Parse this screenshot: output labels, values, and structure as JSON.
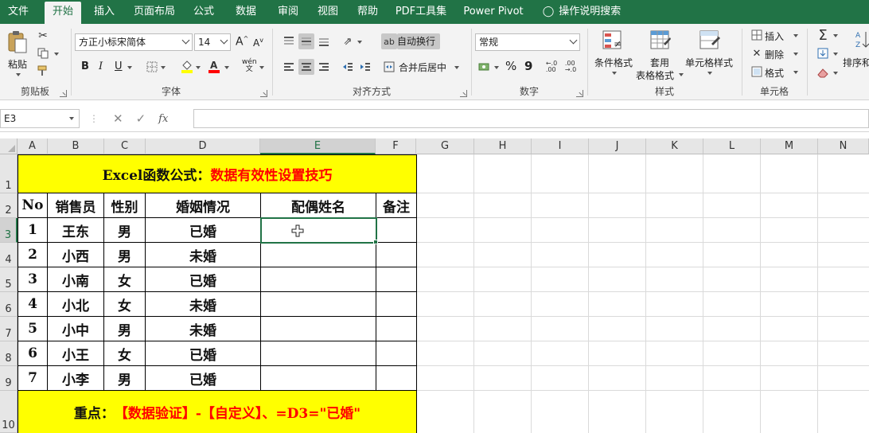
{
  "tabs": [
    "文件",
    "开始",
    "插入",
    "页面布局",
    "公式",
    "数据",
    "审阅",
    "视图",
    "帮助",
    "PDF工具集",
    "Power Pivot",
    "操作说明搜索"
  ],
  "active_tab": "开始",
  "ribbon": {
    "clipboard": {
      "label": "剪贴板",
      "paste": "粘贴"
    },
    "font": {
      "label": "字体",
      "font_name": "方正小标宋简体",
      "font_size": "14",
      "bold": "B",
      "italic": "I",
      "underline": "U",
      "grow": "A",
      "shrink": "A",
      "phonetic": "wén"
    },
    "align": {
      "label": "对齐方式",
      "wrap_text": "自动换行",
      "merge_center": "合并后居中"
    },
    "number": {
      "label": "数字",
      "format": "常规",
      "percent": "%",
      "comma": "9"
    },
    "styles": {
      "label": "样式",
      "conditional": "条件格式",
      "table_format_1": "套用",
      "table_format_2": "表格格式",
      "cell_styles": "单元格样式"
    },
    "cells": {
      "label": "单元格",
      "insert": "插入",
      "delete": "删除",
      "format": "格式"
    },
    "editing": {
      "sort": "排序和"
    }
  },
  "formula_bar": {
    "name_box": "E3",
    "fx": "fx",
    "content": ""
  },
  "columns": [
    "A",
    "B",
    "C",
    "D",
    "E",
    "F",
    "G",
    "H",
    "I",
    "J",
    "K",
    "L",
    "M",
    "N"
  ],
  "rows": [
    "1",
    "2",
    "3",
    "4",
    "5",
    "6",
    "7",
    "8",
    "9",
    "10"
  ],
  "selected_cell": "E3",
  "sheet": {
    "title_black": "Excel函数公式：",
    "title_red": "数据有效性设置技巧",
    "headers": [
      "No",
      "销售员",
      "性别",
      "婚姻情况",
      "配偶姓名",
      "备注"
    ],
    "data": [
      [
        "1",
        "王东",
        "男",
        "已婚",
        "",
        ""
      ],
      [
        "2",
        "小西",
        "男",
        "未婚",
        "",
        ""
      ],
      [
        "3",
        "小南",
        "女",
        "已婚",
        "",
        ""
      ],
      [
        "4",
        "小北",
        "女",
        "未婚",
        "",
        ""
      ],
      [
        "5",
        "小中",
        "男",
        "未婚",
        "",
        ""
      ],
      [
        "6",
        "小王",
        "女",
        "已婚",
        "",
        ""
      ],
      [
        "7",
        "小李",
        "男",
        "已婚",
        "",
        ""
      ]
    ],
    "footer_black": "重点：",
    "footer_red": "【数据验证】-【自定义】、=D3=\"已婚\""
  },
  "colors": {
    "accent": "#217346",
    "highlight": "#ffff00",
    "emphasis": "#ff0000"
  }
}
